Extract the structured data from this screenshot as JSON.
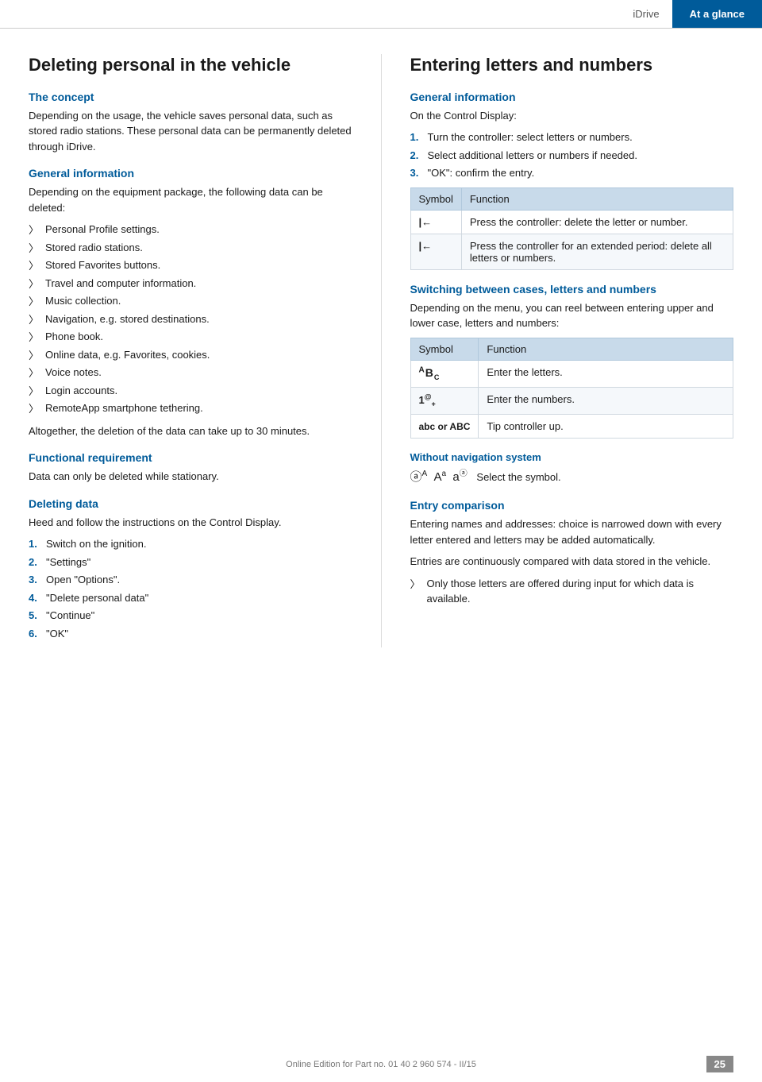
{
  "header": {
    "idrive_label": "iDrive",
    "ataglance_label": "At a glance"
  },
  "left": {
    "page_title": "Deleting personal in the vehicle",
    "concept_heading": "The concept",
    "concept_text": "Depending on the usage, the vehicle saves personal data, such as stored radio stations. These personal data can be permanently deleted through iDrive.",
    "general_info_heading": "General information",
    "general_info_text": "Depending on the equipment package, the following data can be deleted:",
    "bullet_items": [
      "Personal Profile settings.",
      "Stored radio stations.",
      "Stored Favorites buttons.",
      "Travel and computer information.",
      "Music collection.",
      "Navigation, e.g. stored destinations.",
      "Phone book.",
      "Online data, e.g. Favorites, cookies.",
      "Voice notes.",
      "Login accounts.",
      "RemoteApp smartphone tethering."
    ],
    "general_info_footer": "Altogether, the deletion of the data can take up to 30 minutes.",
    "functional_req_heading": "Functional requirement",
    "functional_req_text": "Data can only be deleted while stationary.",
    "deleting_data_heading": "Deleting data",
    "deleting_data_intro": "Heed and follow the instructions on the Control Display.",
    "steps": [
      {
        "num": "1.",
        "text": "Switch on the ignition."
      },
      {
        "num": "2.",
        "text": "\"Settings\""
      },
      {
        "num": "3.",
        "text": "Open \"Options\"."
      },
      {
        "num": "4.",
        "text": "\"Delete personal data\""
      },
      {
        "num": "5.",
        "text": "\"Continue\""
      },
      {
        "num": "6.",
        "text": "\"OK\""
      }
    ]
  },
  "right": {
    "page_title": "Entering letters and numbers",
    "general_info_heading": "General information",
    "general_info_intro": "On the Control Display:",
    "steps": [
      {
        "num": "1.",
        "text": "Turn the controller: select letters or numbers."
      },
      {
        "num": "2.",
        "text": "Select additional letters or numbers if needed."
      },
      {
        "num": "3.",
        "text": "\"OK\": confirm the entry."
      }
    ],
    "table1_headers": [
      "Symbol",
      "Function"
    ],
    "table1_rows": [
      {
        "symbol": "|←",
        "function": "Press the controller: delete the letter or number."
      },
      {
        "symbol": "|←",
        "function": "Press the controller for an extended period: delete all letters or numbers."
      }
    ],
    "switching_heading": "Switching between cases, letters and numbers",
    "switching_text": "Depending on the menu, you can reel between entering upper and lower case, letters and numbers:",
    "table2_headers": [
      "Symbol",
      "Function"
    ],
    "table2_rows": [
      {
        "symbol": "ᴬᴮᴄ",
        "function": "Enter the letters."
      },
      {
        "symbol": "1@₊",
        "function": "Enter the numbers."
      },
      {
        "symbol": "abc or ABC",
        "function": "Tip controller up."
      }
    ],
    "without_nav_heading": "Without navigation system",
    "without_nav_text": "Select the symbol.",
    "without_nav_symbols": "🔤ᴬ  ᴪᵃ  ᵃᵃ",
    "entry_comparison_heading": "Entry comparison",
    "entry_comparison_text1": "Entering names and addresses: choice is narrowed down with every letter entered and letters may be added automatically.",
    "entry_comparison_text2": "Entries are continuously compared with data stored in the vehicle.",
    "entry_comparison_bullet": "Only those letters are offered during input for which data is available."
  },
  "footer": {
    "text": "Online Edition for Part no. 01 40 2 960 574 - II/15",
    "page_num": "25"
  }
}
